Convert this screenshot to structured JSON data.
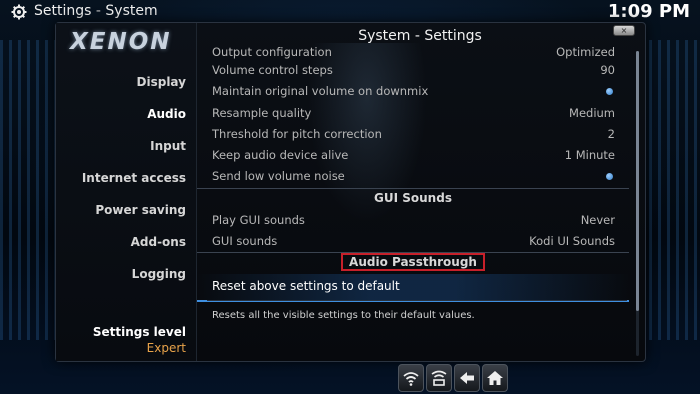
{
  "top_bar": {
    "app_name": "Settings",
    "separator": "-",
    "section": "System",
    "clock": "1:09 PM"
  },
  "window": {
    "logo": "XENON",
    "title": "System - Settings",
    "close_label": "×"
  },
  "sidebar": {
    "items": [
      {
        "label": "Display",
        "active": false
      },
      {
        "label": "Audio",
        "active": true
      },
      {
        "label": "Input",
        "active": false
      },
      {
        "label": "Internet access",
        "active": false
      },
      {
        "label": "Power saving",
        "active": false
      },
      {
        "label": "Add-ons",
        "active": false
      },
      {
        "label": "Logging",
        "active": false
      }
    ],
    "settings_level_label": "Settings level",
    "settings_level_value": "Expert"
  },
  "settings": {
    "partial_row": {
      "label": "Output configuration",
      "value": "Optimized"
    },
    "rows": [
      {
        "label": "Volume control steps",
        "value": "90"
      },
      {
        "label": "Maintain original volume on downmix",
        "value": ""
      },
      {
        "label": "Resample quality",
        "value": "Medium"
      },
      {
        "label": "Threshold for pitch correction",
        "value": "2"
      },
      {
        "label": "Keep audio device alive",
        "value": "1 Minute"
      },
      {
        "label": "Send low volume noise",
        "value": ""
      }
    ],
    "gui_sounds_header": "GUI Sounds",
    "gui_rows": [
      {
        "label": "Play GUI sounds",
        "value": "Never"
      },
      {
        "label": "GUI sounds",
        "value": "Kodi UI Sounds"
      }
    ],
    "passthrough_header": "Audio Passthrough",
    "reset_label": "Reset above settings to default",
    "help_text": "Resets all the visible settings to their default values."
  },
  "toolbar": {
    "icons": [
      "wifi-icon",
      "network-icon",
      "back-arrow-icon",
      "home-icon"
    ]
  },
  "colors": {
    "accent": "#3f8fe0",
    "highlight_box": "#c8202a",
    "level_value": "#e8a34a"
  }
}
